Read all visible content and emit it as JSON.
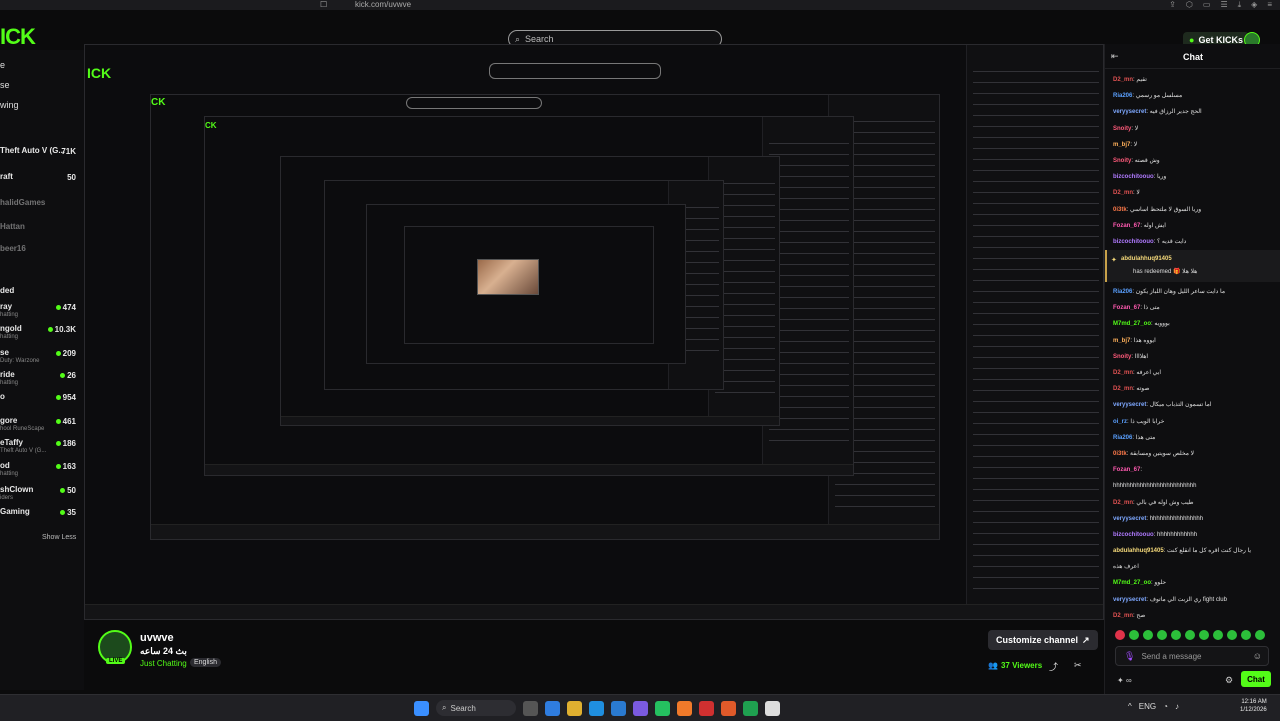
{
  "browser": {
    "url": "kick.com/uvwve"
  },
  "header": {
    "logo": "ICK",
    "search_placeholder": "Search",
    "get_kicks_label": "Get KICKs"
  },
  "sidebar": {
    "nav": [
      "e",
      "se",
      "wing"
    ],
    "channels": [
      {
        "name": "Theft Auto V (G...",
        "sub": "",
        "count": "71K"
      },
      {
        "name": "raft",
        "sub": "",
        "count": "50"
      },
      {
        "name": "halidGames",
        "sub": "",
        "count": ""
      },
      {
        "name": "Hattan",
        "sub": "",
        "count": ""
      },
      {
        "name": "beer16",
        "sub": "",
        "count": ""
      },
      {
        "name": "ded",
        "sub": "",
        "count": ""
      },
      {
        "name": "ray",
        "sub": "hatting",
        "count": "474"
      },
      {
        "name": "ngold",
        "sub": "hatting",
        "count": "10.3K"
      },
      {
        "name": "se",
        "sub": "Duty: Warzone",
        "count": "209"
      },
      {
        "name": "ride",
        "sub": "hatting",
        "count": "26"
      },
      {
        "name": "o",
        "sub": "",
        "count": "954"
      },
      {
        "name": "gore",
        "sub": "hool RuneScape",
        "count": "461"
      },
      {
        "name": "eTaffy",
        "sub": "Theft Auto V (G...",
        "count": "186"
      },
      {
        "name": "od",
        "sub": "hatting",
        "count": "163"
      },
      {
        "name": "shClown",
        "sub": "iders",
        "count": "50"
      },
      {
        "name": "Gaming",
        "sub": "",
        "count": "35"
      }
    ],
    "show_less": "Show Less"
  },
  "stream": {
    "channel_name": "uvwve",
    "title": "بث 24 ساعه",
    "category": "Just Chatting",
    "language": "English",
    "live_badge": "LIVE",
    "customize_label": "Customize channel",
    "viewers": "37 Viewers"
  },
  "chat": {
    "title": "Chat",
    "messages": [
      {
        "user": "D2_mn",
        "color": "#e05252",
        "text": "تقيم"
      },
      {
        "user": "Ria206",
        "color": "#5aa0ff",
        "text": "مسلسل مو رسمي"
      },
      {
        "user": "veryysecret",
        "color": "#7ea8ff",
        "text": "الحج جدير الرزاق فيه"
      },
      {
        "user": "Snoity",
        "color": "#ff5a7a",
        "text": "لا"
      },
      {
        "user": "m_bj7",
        "color": "#ffb05a",
        "text": "لا"
      },
      {
        "user": "Snoity",
        "color": "#ff5a7a",
        "text": "وش قصته"
      },
      {
        "user": "bizcochitoouo",
        "color": "#b07aff",
        "text": "وريا"
      },
      {
        "user": "D2_mn",
        "color": "#e05252",
        "text": "لا"
      },
      {
        "user": "0i3tk",
        "color": "#ff7a4a",
        "text": "وريا السوق لا ملتحظ اساسي"
      },
      {
        "user": "Fozan_67",
        "color": "#ff5ab0",
        "text": "ايش اوله"
      },
      {
        "user": "bizcochitoouo",
        "color": "#b07aff",
        "text": "دايت قديه ؟"
      },
      {
        "user": "Ria206",
        "color": "#5aa0ff",
        "text": "ما دايت ساعر الليل وهان اللباز يكون"
      },
      {
        "user": "Fozan_67",
        "color": "#ff5ab0",
        "text": "متى ذا"
      },
      {
        "user": "M7md_27_oo",
        "color": "#53fc18",
        "text": "بووويه"
      },
      {
        "user": "m_bj7",
        "color": "#ffb05a",
        "text": "ايووه هذا"
      },
      {
        "user": "Snoity",
        "color": "#ff5a7a",
        "text": "اهلاااا"
      },
      {
        "user": "D2_mn",
        "color": "#e05252",
        "text": "ايي اعرفه"
      },
      {
        "user": "D2_mn",
        "color": "#e05252",
        "text": "صوته"
      },
      {
        "user": "veryysecret",
        "color": "#7ea8ff",
        "text": "اما تسمون التذباب ميكال"
      },
      {
        "user": "oi_rz",
        "color": "#5aa0ff",
        "text": "خرابا الويب ذا"
      },
      {
        "user": "Ria206",
        "color": "#5aa0ff",
        "text": "متى هذا"
      },
      {
        "user": "0i3tk",
        "color": "#ff7a4a",
        "text": "لا مخلص سويتين ومسابقة"
      },
      {
        "user": "Fozan_67",
        "color": "#ff5ab0",
        "text": ""
      },
      {
        "user": "",
        "color": "#ffffff",
        "text": "hhhhhhhhhhhhhhhhhhhhhhhhh"
      },
      {
        "user": "D2_mn",
        "color": "#e05252",
        "text": "طيب وش اوله في بالي"
      },
      {
        "user": "veryysecret",
        "color": "#7ea8ff",
        "text": "hhhhhhhhhhhhhhhh"
      },
      {
        "user": "bizcochitoouo",
        "color": "#b07aff",
        "text": "hhhhhhhhhhhh"
      },
      {
        "user": "abdulahhuq91405",
        "color": "#f5d97a",
        "text": "يا رجال كنت اقره كل ما انقلع كنت"
      },
      {
        "user": "",
        "color": "#ffffff",
        "text": "اعرف هذه"
      },
      {
        "user": "M7md_27_oo",
        "color": "#53fc18",
        "text": "حلوو"
      },
      {
        "user": "veryysecret",
        "color": "#7ea8ff",
        "text": "ري الزبت الي ماتوف fight club"
      },
      {
        "user": "D2_mn",
        "color": "#e05252",
        "text": "صح"
      }
    ],
    "redeem": {
      "user": "abdulahhuq91405",
      "text": "has redeemed 🎁 هلا هلا"
    },
    "send_placeholder": "Send a message",
    "send_label": "Chat",
    "tools_label": "∞"
  },
  "taskbar": {
    "search_label": "Search",
    "time": "12:16 AM",
    "date": "1/12/2026",
    "lang": "ENG"
  }
}
